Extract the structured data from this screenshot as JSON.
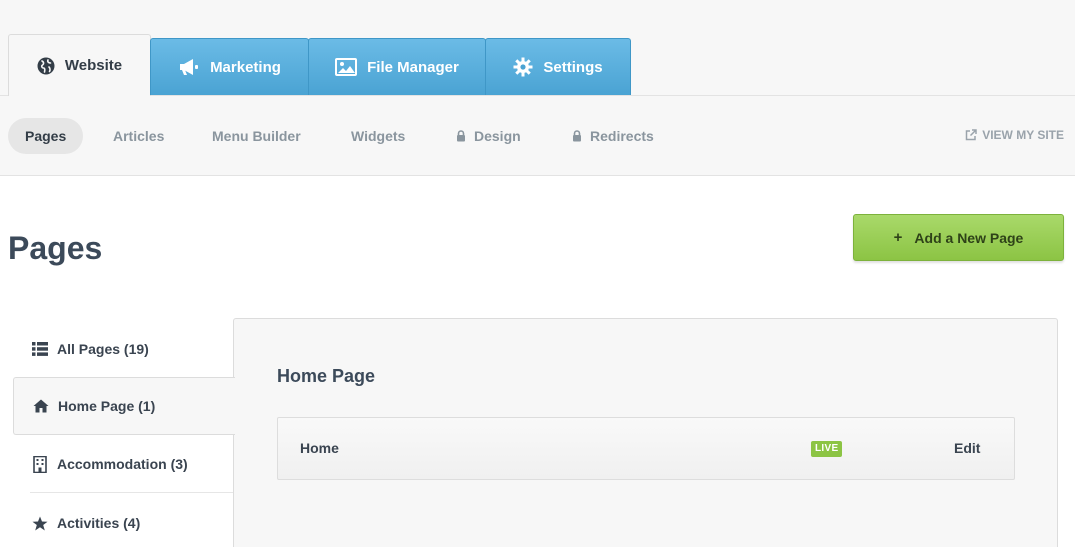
{
  "top_tabs": [
    {
      "label": "Website",
      "icon": "globe-icon",
      "active": true
    },
    {
      "label": "Marketing",
      "icon": "megaphone-icon"
    },
    {
      "label": "File Manager",
      "icon": "image-icon"
    },
    {
      "label": "Settings",
      "icon": "gear-icon"
    }
  ],
  "subnav": {
    "items": [
      {
        "label": "Pages",
        "active": true
      },
      {
        "label": "Articles"
      },
      {
        "label": "Menu Builder"
      },
      {
        "label": "Widgets"
      },
      {
        "label": "Design",
        "locked": true
      },
      {
        "label": "Redirects",
        "locked": true
      }
    ],
    "view_site": "VIEW MY SITE"
  },
  "page": {
    "title": "Pages",
    "add_button": "Add a New Page",
    "add_button_prefix": "+"
  },
  "sidebar": {
    "items": [
      {
        "label": "All Pages (19)",
        "icon": "list-icon"
      },
      {
        "label": "Home Page (1)",
        "icon": "home-icon",
        "active": true
      },
      {
        "label": "Accommodation (3)",
        "icon": "building-icon"
      },
      {
        "label": "Activities (4)",
        "icon": "star-icon"
      }
    ]
  },
  "panel": {
    "title": "Home Page",
    "rows": [
      {
        "name": "Home",
        "status": "LIVE",
        "action": "Edit"
      }
    ]
  },
  "colors": {
    "tab_blue": "#4aa3d3",
    "add_green": "#8cc444",
    "live_green": "#8cc444",
    "text_dark": "#3c4a5a",
    "text_muted": "#8a959e"
  }
}
